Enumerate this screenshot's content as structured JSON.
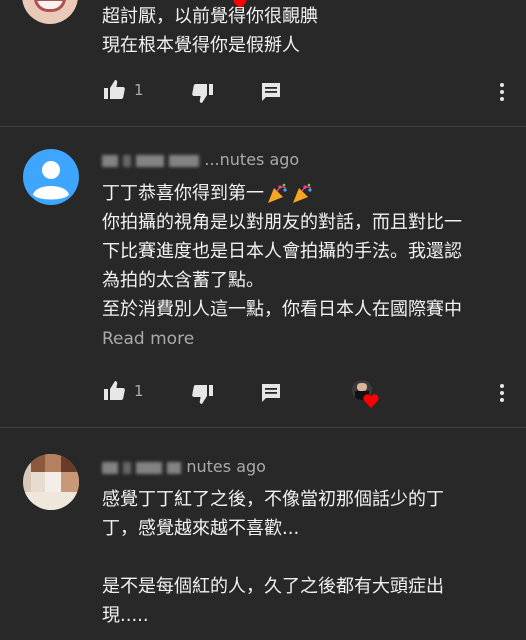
{
  "comments": [
    {
      "lines": [
        "超討厭，以前覺得你很靦腆",
        "現在根本覺得你是假掰人"
      ],
      "likes": "1"
    },
    {
      "time": "...nutes ago",
      "lines": [
        "丁丁恭喜你得到第一",
        "你拍攝的視角是以對朋友的對話，而且對比一",
        "下比賽進度也是日本人會拍攝的手法。我還認",
        "為拍的太含蓄了點。",
        "至於消費別人這一點，你看日本人在國際賽中"
      ],
      "read_more": "Read more",
      "likes": "1"
    },
    {
      "time": "nutes ago",
      "lines": [
        "感覺丁丁紅了之後，不像當初那個話少的丁",
        "丁，感覺越來越不喜歡...",
        "",
        "是不是每個紅的人，久了之後都有大頭症出",
        "現....."
      ]
    }
  ],
  "colors": {
    "background": "#282828",
    "text": "#f1f1f1",
    "secondary": "#aaaaaa",
    "avatar_blue": "#3ea6ff",
    "heart": "#ff0000"
  }
}
